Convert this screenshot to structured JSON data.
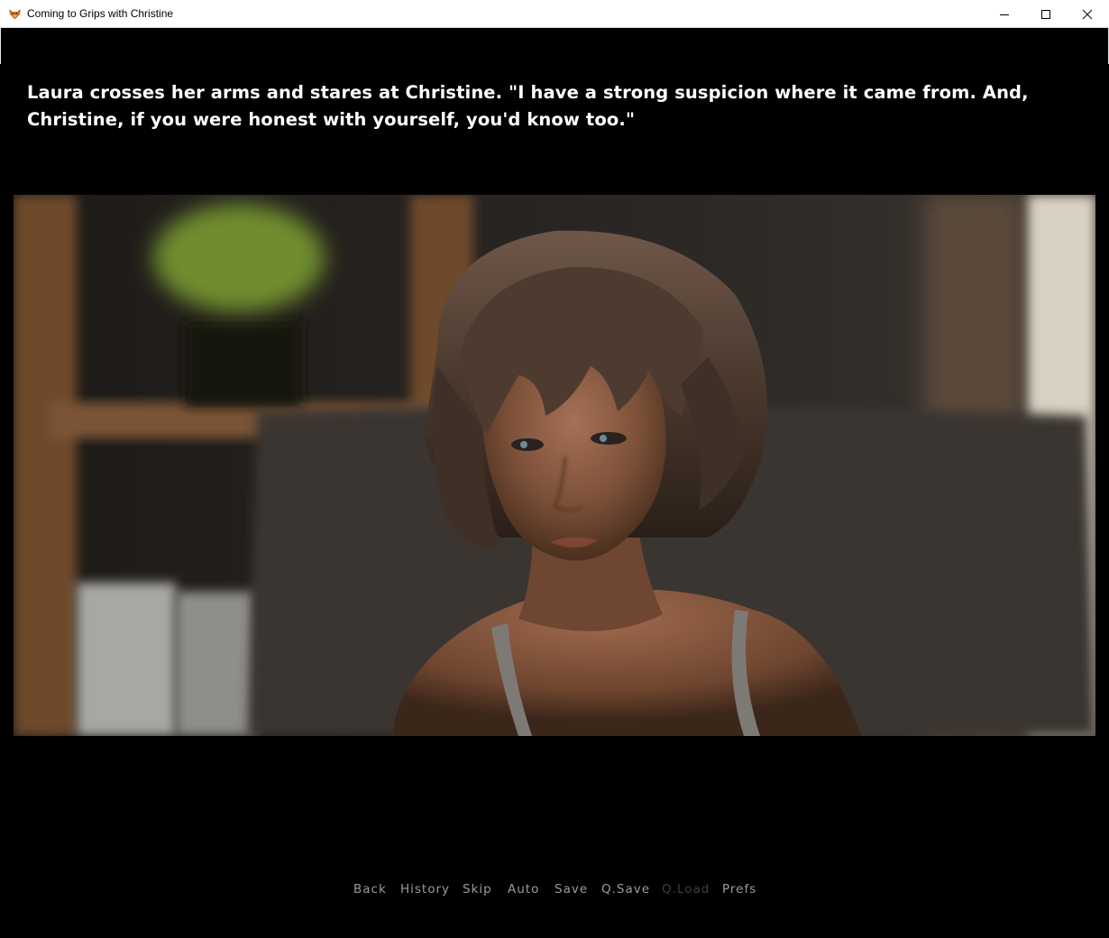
{
  "window": {
    "title": "Coming to Grips with Christine",
    "icon": "fox-icon"
  },
  "dialogue": {
    "text": "Laura crosses her arms and stares at Christine. \"I have a strong suspicion where it came from. And, Christine, if you were honest with yourself, you'd know too.\""
  },
  "quick_menu": {
    "back": "Back",
    "history": "History",
    "skip": "Skip",
    "auto": "Auto",
    "save": "Save",
    "qsave": "Q.Save",
    "qload": "Q.Load",
    "prefs": "Prefs"
  },
  "colors": {
    "background": "#000000",
    "dialogue_text": "#ffffff",
    "menu_text": "#9a9a9a",
    "menu_disabled": "#3f3f3f"
  }
}
